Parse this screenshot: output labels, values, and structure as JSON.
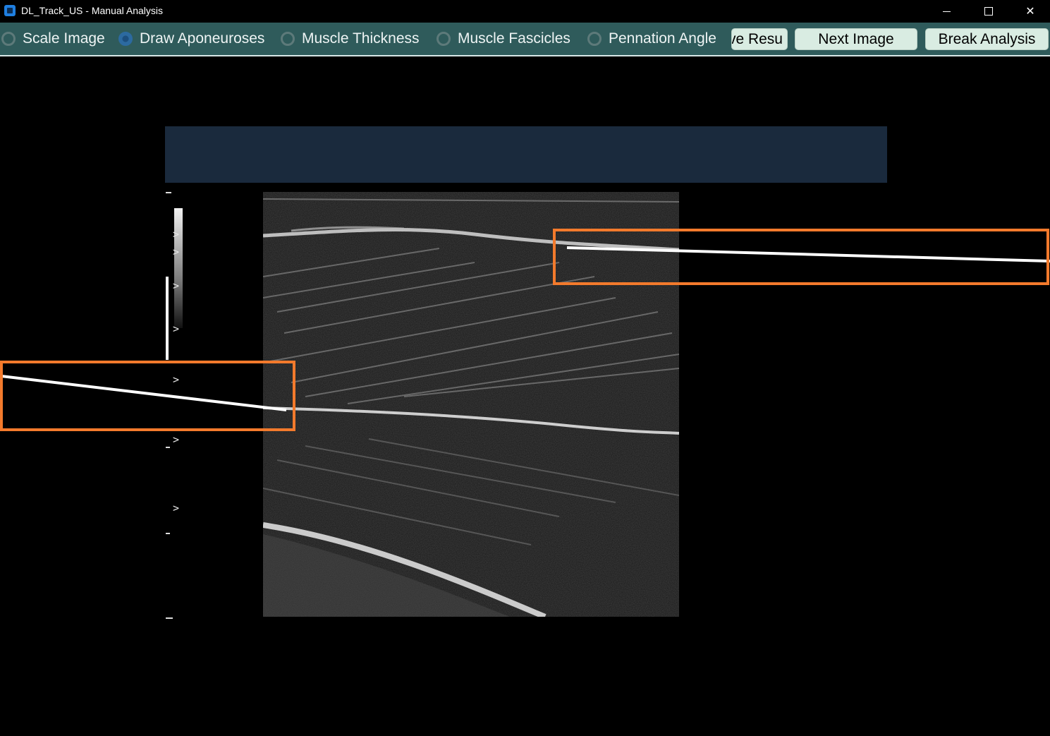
{
  "window": {
    "title": "DL_Track_US - Manual Analysis",
    "controls": [
      "minimize-icon",
      "maximize-icon",
      "close-icon"
    ]
  },
  "toolbar": {
    "radio_options": [
      {
        "label": "Scale Image",
        "selected": false
      },
      {
        "label": "Draw Aponeuroses",
        "selected": true
      },
      {
        "label": "Muscle Thickness",
        "selected": false
      },
      {
        "label": "Muscle Fascicles",
        "selected": false
      },
      {
        "label": "Pennation Angle",
        "selected": false
      }
    ],
    "save_label": "ve Resu",
    "next_label": "Next Image",
    "break_label": "Break Analysis"
  },
  "image": {
    "depth_markers": [
      ">",
      ">",
      ">",
      ">",
      ">",
      ">",
      ">"
    ]
  },
  "colors": {
    "toolbar_bg": "#2f5b5b",
    "button_bg": "#d9ece2",
    "highlight": "#f37a2c",
    "header_band": "#1a2a3d"
  }
}
